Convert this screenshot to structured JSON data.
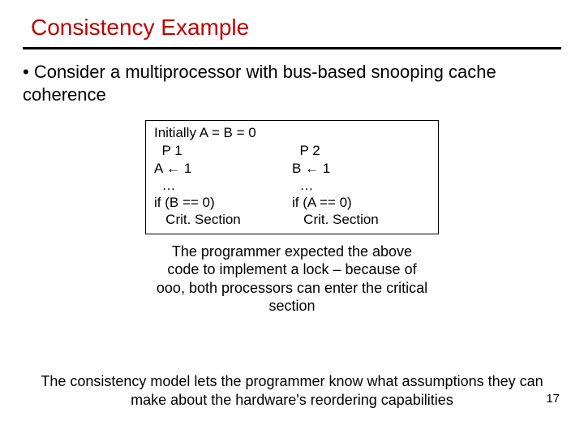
{
  "title": "Consistency Example",
  "bullet": "• Consider a multiprocessor with bus-based snooping cache coherence",
  "codebox": {
    "init": "Initially A = B = 0",
    "p1": {
      "label": "  P 1",
      "l1_pre": "A ",
      "l1_post": " 1",
      "l2": "  …",
      "l3": "if (B == 0)",
      "l4": "   Crit. Section"
    },
    "p2": {
      "label": "  P 2",
      "l1_pre": "B ",
      "l1_post": " 1",
      "l2": "  …",
      "l3": "if (A == 0)",
      "l4": "   Crit. Section"
    },
    "arrow": "←"
  },
  "caption": "The programmer expected the above code to implement a lock – because of ooo, both processors can enter the critical section",
  "footer": "The consistency model lets the programmer know what assumptions they can make about the hardware's reordering capabilities",
  "pagenum": "17"
}
